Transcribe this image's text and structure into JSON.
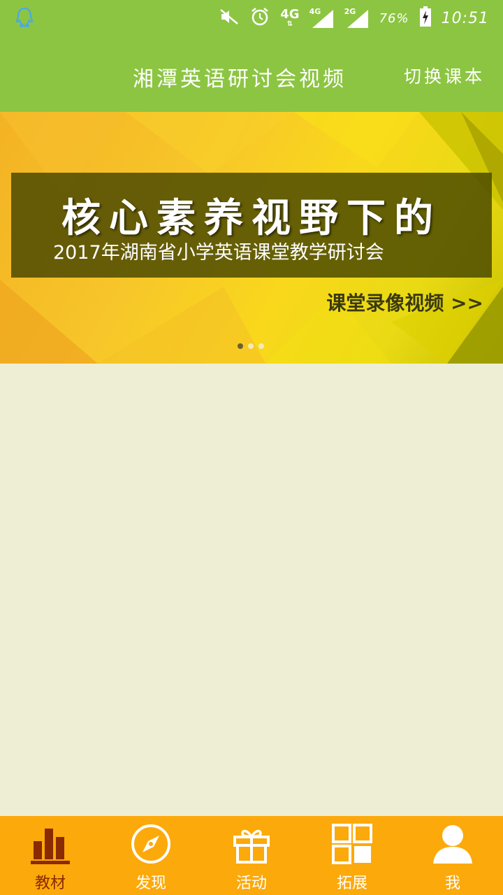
{
  "status_bar": {
    "network_label": "4G",
    "sim1_label": "4G",
    "sim2_label": "2G",
    "battery": "76%",
    "time": "10:51"
  },
  "header": {
    "title": "湘潭英语研讨会视频",
    "switch_label": "切换课本"
  },
  "banner": {
    "headline": "核心素养视野下的",
    "subtitle": "2017年湖南省小学英语课堂教学研讨会",
    "link": "课堂录像视频 >>",
    "page_count": 3,
    "active_page": 1
  },
  "bottom_nav": {
    "items": [
      {
        "label": "教材",
        "icon": "bar-chart-icon",
        "active": true
      },
      {
        "label": "发现",
        "icon": "compass-icon",
        "active": false
      },
      {
        "label": "活动",
        "icon": "gift-icon",
        "active": false
      },
      {
        "label": "拓展",
        "icon": "grid-icon",
        "active": false
      },
      {
        "label": "我",
        "icon": "person-icon",
        "active": false
      }
    ]
  },
  "colors": {
    "header_green": "#8cc542",
    "nav_orange": "#fca90b",
    "content_bg": "#eeeed5",
    "active_nav": "#8a2a00"
  }
}
